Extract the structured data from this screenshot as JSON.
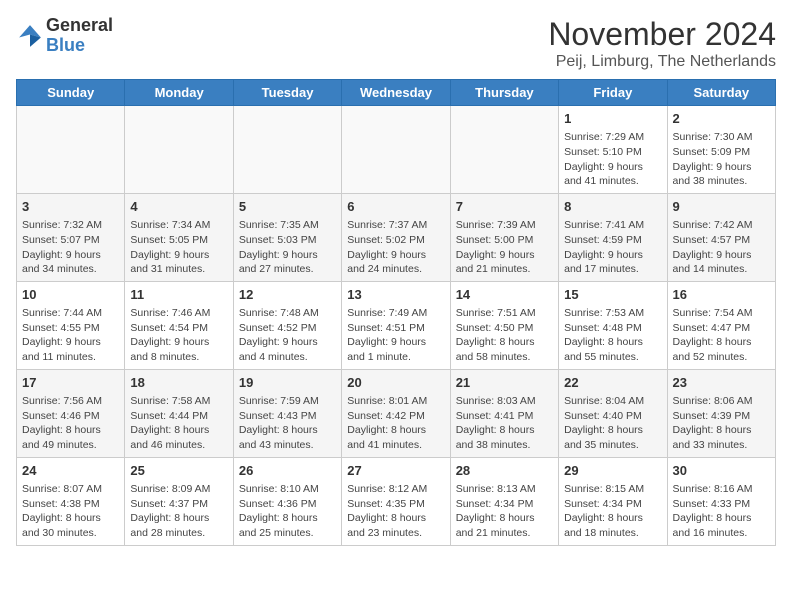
{
  "header": {
    "logo": {
      "line1": "General",
      "line2": "Blue"
    },
    "title": "November 2024",
    "subtitle": "Peij, Limburg, The Netherlands"
  },
  "calendar": {
    "columns": [
      "Sunday",
      "Monday",
      "Tuesday",
      "Wednesday",
      "Thursday",
      "Friday",
      "Saturday"
    ],
    "rows": [
      [
        {
          "day": "",
          "info": ""
        },
        {
          "day": "",
          "info": ""
        },
        {
          "day": "",
          "info": ""
        },
        {
          "day": "",
          "info": ""
        },
        {
          "day": "",
          "info": ""
        },
        {
          "day": "1",
          "info": "Sunrise: 7:29 AM\nSunset: 5:10 PM\nDaylight: 9 hours and 41 minutes."
        },
        {
          "day": "2",
          "info": "Sunrise: 7:30 AM\nSunset: 5:09 PM\nDaylight: 9 hours and 38 minutes."
        }
      ],
      [
        {
          "day": "3",
          "info": "Sunrise: 7:32 AM\nSunset: 5:07 PM\nDaylight: 9 hours and 34 minutes."
        },
        {
          "day": "4",
          "info": "Sunrise: 7:34 AM\nSunset: 5:05 PM\nDaylight: 9 hours and 31 minutes."
        },
        {
          "day": "5",
          "info": "Sunrise: 7:35 AM\nSunset: 5:03 PM\nDaylight: 9 hours and 27 minutes."
        },
        {
          "day": "6",
          "info": "Sunrise: 7:37 AM\nSunset: 5:02 PM\nDaylight: 9 hours and 24 minutes."
        },
        {
          "day": "7",
          "info": "Sunrise: 7:39 AM\nSunset: 5:00 PM\nDaylight: 9 hours and 21 minutes."
        },
        {
          "day": "8",
          "info": "Sunrise: 7:41 AM\nSunset: 4:59 PM\nDaylight: 9 hours and 17 minutes."
        },
        {
          "day": "9",
          "info": "Sunrise: 7:42 AM\nSunset: 4:57 PM\nDaylight: 9 hours and 14 minutes."
        }
      ],
      [
        {
          "day": "10",
          "info": "Sunrise: 7:44 AM\nSunset: 4:55 PM\nDaylight: 9 hours and 11 minutes."
        },
        {
          "day": "11",
          "info": "Sunrise: 7:46 AM\nSunset: 4:54 PM\nDaylight: 9 hours and 8 minutes."
        },
        {
          "day": "12",
          "info": "Sunrise: 7:48 AM\nSunset: 4:52 PM\nDaylight: 9 hours and 4 minutes."
        },
        {
          "day": "13",
          "info": "Sunrise: 7:49 AM\nSunset: 4:51 PM\nDaylight: 9 hours and 1 minute."
        },
        {
          "day": "14",
          "info": "Sunrise: 7:51 AM\nSunset: 4:50 PM\nDaylight: 8 hours and 58 minutes."
        },
        {
          "day": "15",
          "info": "Sunrise: 7:53 AM\nSunset: 4:48 PM\nDaylight: 8 hours and 55 minutes."
        },
        {
          "day": "16",
          "info": "Sunrise: 7:54 AM\nSunset: 4:47 PM\nDaylight: 8 hours and 52 minutes."
        }
      ],
      [
        {
          "day": "17",
          "info": "Sunrise: 7:56 AM\nSunset: 4:46 PM\nDaylight: 8 hours and 49 minutes."
        },
        {
          "day": "18",
          "info": "Sunrise: 7:58 AM\nSunset: 4:44 PM\nDaylight: 8 hours and 46 minutes."
        },
        {
          "day": "19",
          "info": "Sunrise: 7:59 AM\nSunset: 4:43 PM\nDaylight: 8 hours and 43 minutes."
        },
        {
          "day": "20",
          "info": "Sunrise: 8:01 AM\nSunset: 4:42 PM\nDaylight: 8 hours and 41 minutes."
        },
        {
          "day": "21",
          "info": "Sunrise: 8:03 AM\nSunset: 4:41 PM\nDaylight: 8 hours and 38 minutes."
        },
        {
          "day": "22",
          "info": "Sunrise: 8:04 AM\nSunset: 4:40 PM\nDaylight: 8 hours and 35 minutes."
        },
        {
          "day": "23",
          "info": "Sunrise: 8:06 AM\nSunset: 4:39 PM\nDaylight: 8 hours and 33 minutes."
        }
      ],
      [
        {
          "day": "24",
          "info": "Sunrise: 8:07 AM\nSunset: 4:38 PM\nDaylight: 8 hours and 30 minutes."
        },
        {
          "day": "25",
          "info": "Sunrise: 8:09 AM\nSunset: 4:37 PM\nDaylight: 8 hours and 28 minutes."
        },
        {
          "day": "26",
          "info": "Sunrise: 8:10 AM\nSunset: 4:36 PM\nDaylight: 8 hours and 25 minutes."
        },
        {
          "day": "27",
          "info": "Sunrise: 8:12 AM\nSunset: 4:35 PM\nDaylight: 8 hours and 23 minutes."
        },
        {
          "day": "28",
          "info": "Sunrise: 8:13 AM\nSunset: 4:34 PM\nDaylight: 8 hours and 21 minutes."
        },
        {
          "day": "29",
          "info": "Sunrise: 8:15 AM\nSunset: 4:34 PM\nDaylight: 8 hours and 18 minutes."
        },
        {
          "day": "30",
          "info": "Sunrise: 8:16 AM\nSunset: 4:33 PM\nDaylight: 8 hours and 16 minutes."
        }
      ]
    ]
  }
}
